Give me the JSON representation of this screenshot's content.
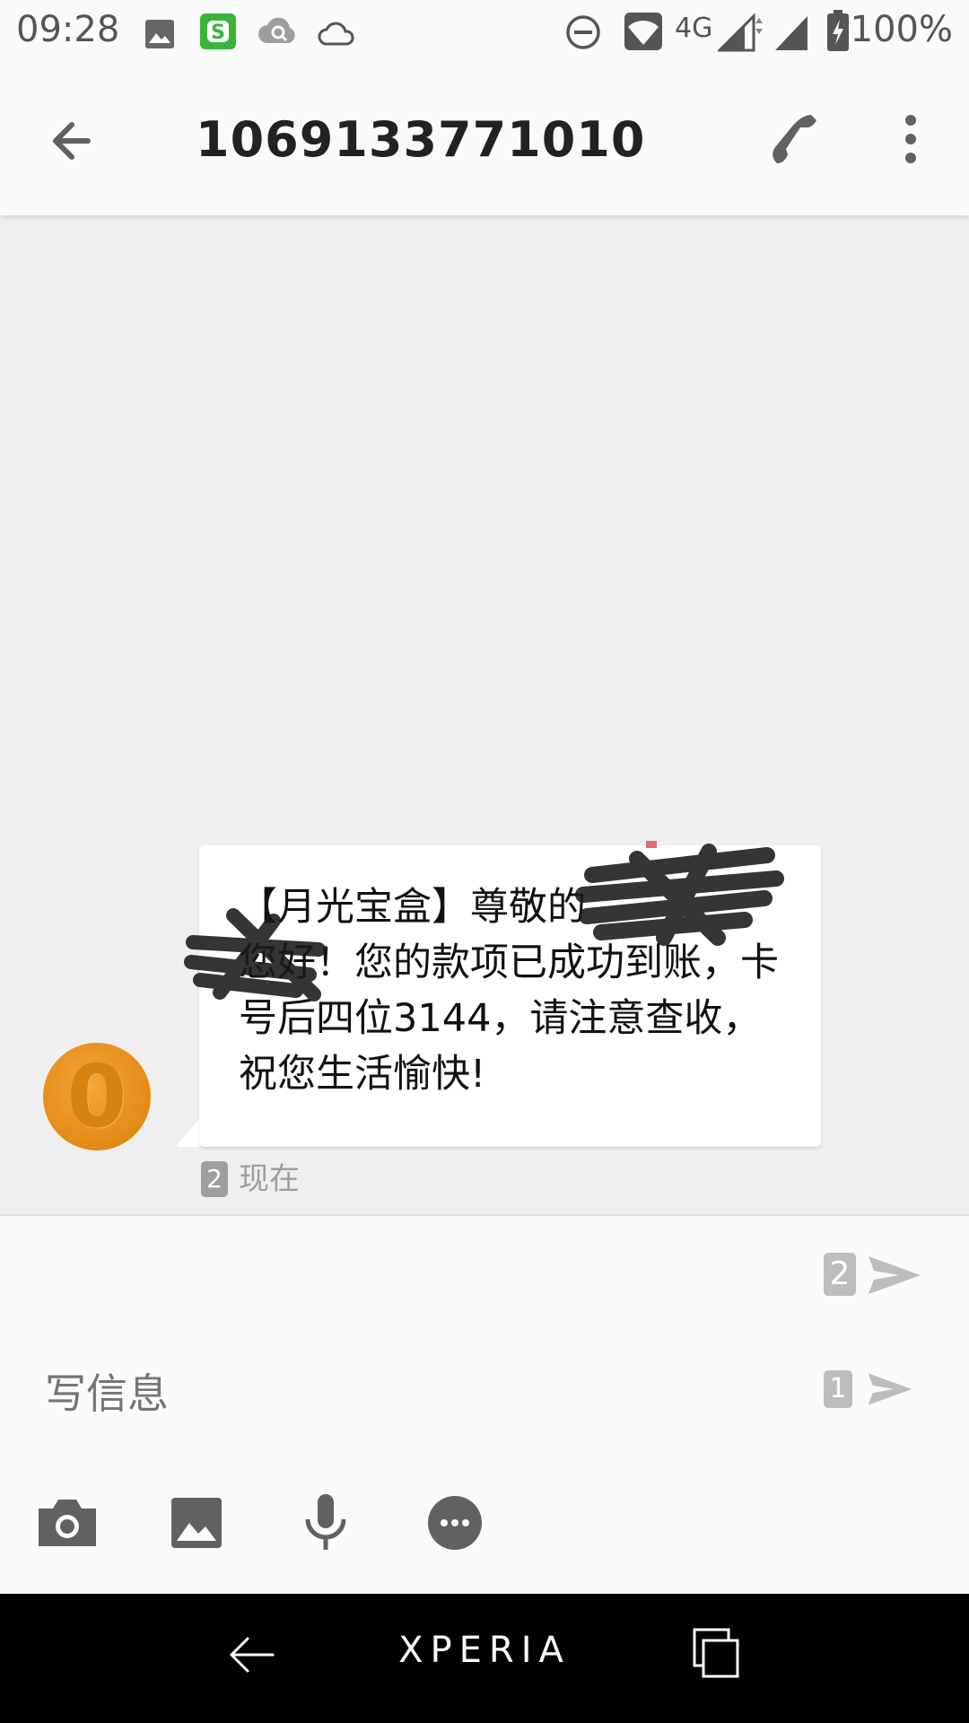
{
  "status_bar": {
    "time": "09:28",
    "network": "4G",
    "battery": "100%"
  },
  "header": {
    "title": "1069133771010"
  },
  "message": {
    "text": "【月光宝盒】尊敬的　　　　　　您好！您的款项已成功到账，卡号后四位3144，请注意查收，祝您生活愉快!",
    "sim": "2",
    "time": "现在",
    "avatar_letter": "0"
  },
  "composer": {
    "placeholder": "写信息",
    "send_sim_2": "2",
    "send_sim_1": "1"
  },
  "nav": {
    "brand": "XPERIA"
  },
  "colors": {
    "avatar": "#e89418",
    "background": "#efefef",
    "icon": "#616161"
  }
}
